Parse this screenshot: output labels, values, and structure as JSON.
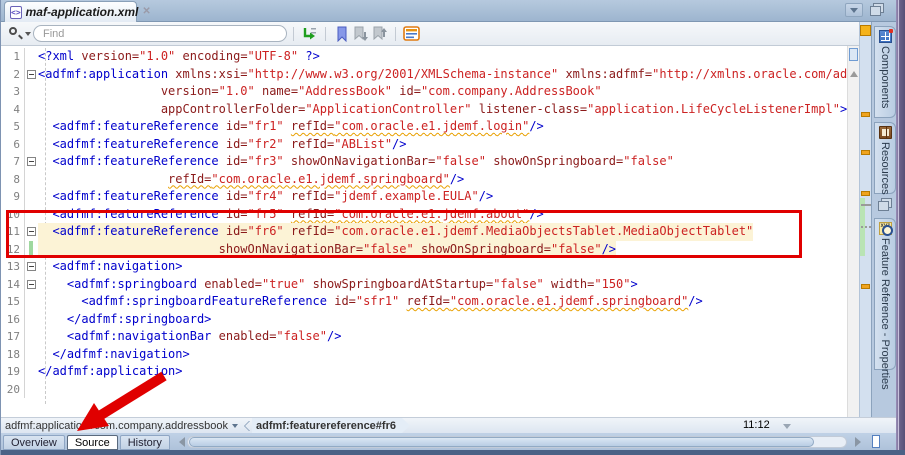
{
  "window": {
    "kind": "xml-source-editor"
  },
  "editor_tab": {
    "title": "maf-application.xml",
    "close_glyph": "x",
    "icon": "xml-file-icon"
  },
  "toolbar": {
    "find_placeholder": "Find",
    "icons": [
      "search-dropdown-icon",
      "go-to-last-edit-icon",
      "toggle-bookmark-icon",
      "next-bookmark-icon",
      "previous-bookmark-icon",
      "highlight-occurrences-icon"
    ]
  },
  "editor": {
    "highlight_color": "#fcf3d6",
    "warning_color": "#e8a000",
    "lines": [
      {
        "n": 1,
        "t": [
          [
            "tag",
            "<?xml "
          ],
          [
            "attr",
            "version="
          ],
          [
            "val",
            "\"1.0\""
          ],
          [
            "txt",
            " "
          ],
          [
            "attr",
            "encoding="
          ],
          [
            "val",
            "\"UTF-8\""
          ],
          [
            "tag",
            " ?>"
          ]
        ]
      },
      {
        "n": 2,
        "fold": true,
        "t": [
          [
            "tag",
            "<adfmf:application "
          ],
          [
            "attr",
            "xmlns:xsi="
          ],
          [
            "val",
            "\"http://www.w3.org/2001/XMLSchema-instance\""
          ],
          [
            "txt",
            " "
          ],
          [
            "attr",
            "xmlns:adfmf="
          ],
          [
            "val",
            "\"http://xmlns.oracle.com/adf/mf\""
          ]
        ]
      },
      {
        "n": 3,
        "t": [
          [
            "txt",
            "                 "
          ],
          [
            "attr",
            "version="
          ],
          [
            "val",
            "\"1.0\""
          ],
          [
            "txt",
            " "
          ],
          [
            "attr",
            "name="
          ],
          [
            "val",
            "\"AddressBook\""
          ],
          [
            "txt",
            " "
          ],
          [
            "attr",
            "id="
          ],
          [
            "val",
            "\"com.company.AddressBook\""
          ]
        ]
      },
      {
        "n": 4,
        "t": [
          [
            "txt",
            "                 "
          ],
          [
            "attr",
            "appControllerFolder="
          ],
          [
            "val",
            "\"ApplicationController\""
          ],
          [
            "txt",
            " "
          ],
          [
            "attr",
            "listener-class="
          ],
          [
            "val",
            "\"application.LifeCycleListenerImpl\""
          ],
          [
            "tag",
            ">"
          ]
        ]
      },
      {
        "n": 5,
        "t": [
          [
            "txt",
            "  "
          ],
          [
            "tag",
            "<adfmf:featureReference "
          ],
          [
            "attr",
            "id="
          ],
          [
            "val",
            "\"fr1\""
          ],
          [
            "txt",
            " "
          ],
          [
            "wattr",
            "refId="
          ],
          [
            "wval",
            "\"com.oracle.e1.jdemf.login\""
          ],
          [
            "tag",
            "/>"
          ]
        ]
      },
      {
        "n": 6,
        "t": [
          [
            "txt",
            "  "
          ],
          [
            "tag",
            "<adfmf:featureReference "
          ],
          [
            "attr",
            "id="
          ],
          [
            "val",
            "\"fr2\""
          ],
          [
            "txt",
            " "
          ],
          [
            "attr",
            "refId="
          ],
          [
            "val",
            "\"ABList\""
          ],
          [
            "tag",
            "/>"
          ]
        ]
      },
      {
        "n": 7,
        "fold": true,
        "t": [
          [
            "txt",
            "  "
          ],
          [
            "tag",
            "<adfmf:featureReference "
          ],
          [
            "attr",
            "id="
          ],
          [
            "val",
            "\"fr3\""
          ],
          [
            "txt",
            " "
          ],
          [
            "attr",
            "showOnNavigationBar="
          ],
          [
            "val",
            "\"false\""
          ],
          [
            "txt",
            " "
          ],
          [
            "attr",
            "showOnSpringboard="
          ],
          [
            "val",
            "\"false\""
          ]
        ]
      },
      {
        "n": 8,
        "t": [
          [
            "txt",
            "                  "
          ],
          [
            "wattr",
            "refId="
          ],
          [
            "wval",
            "\"com.oracle.e1.jdemf.springboard\""
          ],
          [
            "tag",
            "/>"
          ]
        ]
      },
      {
        "n": 9,
        "t": [
          [
            "txt",
            "  "
          ],
          [
            "tag",
            "<adfmf:featureReference "
          ],
          [
            "attr",
            "id="
          ],
          [
            "val",
            "\"fr4\""
          ],
          [
            "txt",
            " "
          ],
          [
            "attr",
            "refId="
          ],
          [
            "val",
            "\"jdemf.example.EULA\""
          ],
          [
            "tag",
            "/>"
          ]
        ]
      },
      {
        "n": 10,
        "t": [
          [
            "txt",
            "  "
          ],
          [
            "tag",
            "<adfmf:featureReference "
          ],
          [
            "attr",
            "id="
          ],
          [
            "val",
            "\"fr5\""
          ],
          [
            "txt",
            " "
          ],
          [
            "wattr",
            "refId="
          ],
          [
            "wval",
            "\"com.oracle.e1.jdemf.about\""
          ],
          [
            "tag",
            "/>"
          ]
        ]
      },
      {
        "n": 11,
        "fold": true,
        "hl": true,
        "t": [
          [
            "txt",
            "  "
          ],
          [
            "tag",
            "<adfmf:featureReference "
          ],
          [
            "attr",
            "id="
          ],
          [
            "val",
            "\"fr6\""
          ],
          [
            "txt",
            " "
          ],
          [
            "attr",
            "refId="
          ],
          [
            "val",
            "\"com.oracle.e1.jdemf.MediaObjectsTablet.MediaObjectTablet\""
          ]
        ]
      },
      {
        "n": 12,
        "hl": true,
        "t": [
          [
            "txt",
            "                         "
          ],
          [
            "attr",
            "showOnNavigationBar="
          ],
          [
            "val",
            "\"false\""
          ],
          [
            "txt",
            " "
          ],
          [
            "attr",
            "showOnSpringboard="
          ],
          [
            "val",
            "\"false\""
          ],
          [
            "tag",
            "/>"
          ]
        ]
      },
      {
        "n": 13,
        "fold": true,
        "t": [
          [
            "txt",
            "  "
          ],
          [
            "tag",
            "<adfmf:navigation>"
          ]
        ]
      },
      {
        "n": 14,
        "fold": true,
        "t": [
          [
            "txt",
            "    "
          ],
          [
            "tag",
            "<adfmf:springboard "
          ],
          [
            "attr",
            "enabled="
          ],
          [
            "val",
            "\"true\""
          ],
          [
            "txt",
            " "
          ],
          [
            "attr",
            "showSpringboardAtStartup="
          ],
          [
            "val",
            "\"false\""
          ],
          [
            "txt",
            " "
          ],
          [
            "attr",
            "width="
          ],
          [
            "val",
            "\"150\""
          ],
          [
            "tag",
            ">"
          ]
        ]
      },
      {
        "n": 15,
        "t": [
          [
            "txt",
            "      "
          ],
          [
            "tag",
            "<adfmf:springboardFeatureReference "
          ],
          [
            "attr",
            "id="
          ],
          [
            "val",
            "\"sfr1\""
          ],
          [
            "txt",
            " "
          ],
          [
            "wattr",
            "refId="
          ],
          [
            "wval",
            "\"com.oracle.e1.jdemf.springboard\""
          ],
          [
            "tag",
            "/>"
          ]
        ]
      },
      {
        "n": 16,
        "t": [
          [
            "txt",
            "    "
          ],
          [
            "tag",
            "</adfmf:springboard>"
          ]
        ]
      },
      {
        "n": 17,
        "t": [
          [
            "txt",
            "    "
          ],
          [
            "tag",
            "<adfmf:navigationBar "
          ],
          [
            "attr",
            "enabled="
          ],
          [
            "val",
            "\"false\""
          ],
          [
            "tag",
            "/>"
          ]
        ]
      },
      {
        "n": 18,
        "t": [
          [
            "txt",
            "  "
          ],
          [
            "tag",
            "</adfmf:navigation>"
          ]
        ]
      },
      {
        "n": 19,
        "t": [
          [
            "tag",
            "</adfmf:application>"
          ]
        ]
      },
      {
        "n": 20,
        "t": []
      }
    ]
  },
  "right_panel": {
    "tabs": [
      {
        "label": "Components",
        "icon": "components-icon"
      },
      {
        "label": "Resources",
        "icon": "resources-icon"
      },
      {
        "label": "Feature Reference - Properties",
        "icon": "properties-icon"
      }
    ]
  },
  "breadcrumb": {
    "items": [
      {
        "label": "adfmf:application#com.company.addressbook",
        "dropdown": true,
        "bold": false
      },
      {
        "label": "adfmf:featurereference#fr6",
        "dropdown": false,
        "bold": true
      }
    ]
  },
  "bottom_tabs": {
    "items": [
      "Overview",
      "Source",
      "History"
    ],
    "active": "Source"
  },
  "status": {
    "position": "11:12"
  },
  "annotations": {
    "box_color": "#e00000",
    "arrow_color": "#e00000"
  }
}
